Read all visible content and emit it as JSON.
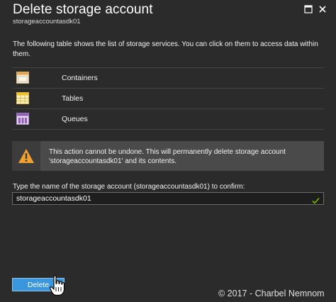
{
  "header": {
    "title": "Delete storage account",
    "subtitle": "storageaccountasdk01",
    "maximize_icon": "maximize-icon",
    "close_icon": "close-icon"
  },
  "description": "The following table shows the list of storage services. You can click on them to access data within them.",
  "services": [
    {
      "label": "Containers",
      "icon": "containers-icon"
    },
    {
      "label": "Tables",
      "icon": "tables-icon"
    },
    {
      "label": "Queues",
      "icon": "queues-icon"
    }
  ],
  "warning": {
    "icon": "warning-icon",
    "text": "This action cannot be undone. This will permanently delete storage account 'storageaccountasdk01' and its contents."
  },
  "confirm": {
    "label": "Type the name of the storage account (storageaccountasdk01) to confirm:",
    "value": "storageaccountasdk01",
    "valid_icon": "check-icon"
  },
  "actions": {
    "delete_label": "Delete"
  },
  "footer": {
    "copyright": "© 2017 - Charbel Nemnom"
  },
  "colors": {
    "background": "#2b2b2b",
    "accent": "#3a96dd",
    "warning": "#f0a030",
    "valid": "#7fba00"
  }
}
